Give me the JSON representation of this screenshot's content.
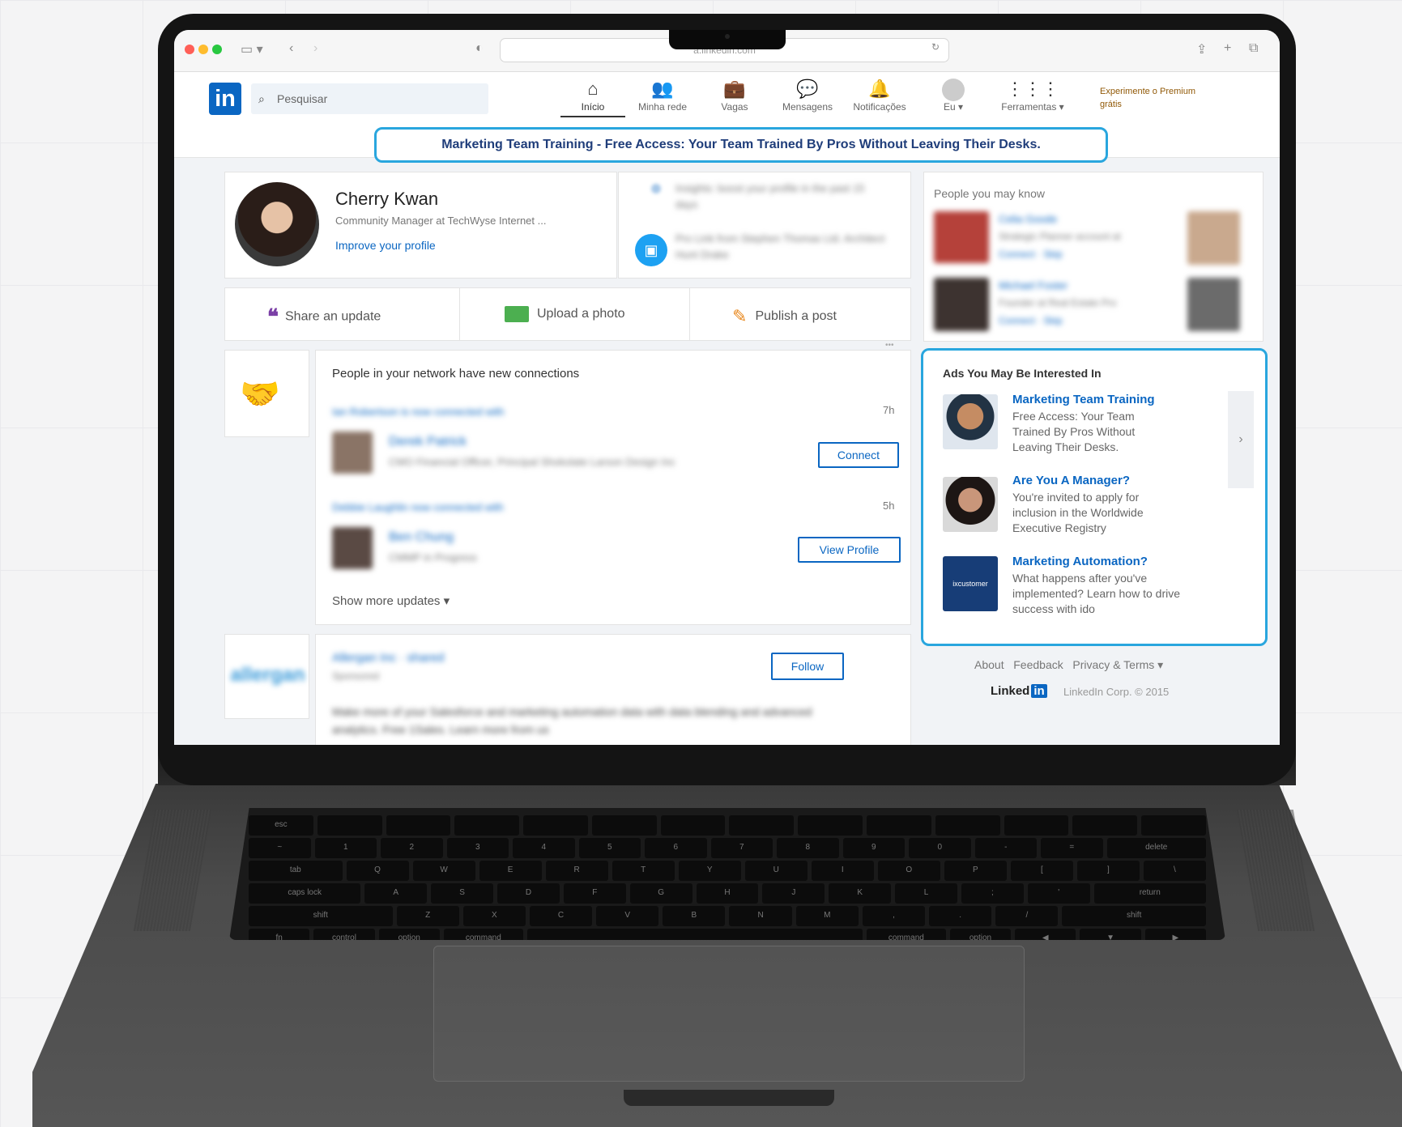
{
  "browser": {
    "url": "a.linkedin.com"
  },
  "linkedin": {
    "search_placeholder": "Pesquisar",
    "nav": [
      {
        "label": "Início",
        "icon": "home-icon"
      },
      {
        "label": "Minha rede",
        "icon": "network-icon"
      },
      {
        "label": "Vagas",
        "icon": "briefcase-icon"
      },
      {
        "label": "Mensagens",
        "icon": "message-icon"
      },
      {
        "label": "Notificações",
        "icon": "bell-icon"
      },
      {
        "label": "Eu ▾",
        "icon": "avatar-icon"
      },
      {
        "label": "Ferramentas ▾",
        "icon": "grid-icon"
      }
    ],
    "premium": "Experimente o Premium grátis"
  },
  "banner": "Marketing Team Training - Free Access: Your Team Trained By Pros Without Leaving Their Desks.",
  "profile": {
    "name": "Cherry Kwan",
    "headline": "Community Manager at TechWyse Internet ...",
    "improve": "Improve your profile",
    "side1": "Insights: boost your profile in the past 15 days",
    "side2": "Pro Link from Stephen Thomas Ltd. Architect Hunt Drake"
  },
  "share": {
    "update": "Share an update",
    "photo": "Upload a photo",
    "post": "Publish a post",
    "dots": "•••"
  },
  "feed": {
    "title": "People in your network have new connections",
    "items": [
      {
        "who": "Ian Robertson is now connected with",
        "time": "7h",
        "name": "Derek Patrick",
        "sub": "CMO Financial Officer, Principal Shokolate Larson Design Inc",
        "button": "Connect"
      },
      {
        "who": "Debbie Laughlin now connected with",
        "time": "5h",
        "name": "Ben Chung",
        "sub": "CMMP in Progress",
        "button": "View Profile"
      }
    ],
    "more": "Show more updates ▾"
  },
  "sponsored": {
    "logo": "allergan",
    "company": "Allergan Inc · shared",
    "tag": "Sponsored",
    "button": "Follow",
    "text": "Make more of your Salesforce and marketing automation data with data blending and advanced analytics. Free 1Sales. Learn more from us"
  },
  "pymk": {
    "title": "People you may know",
    "people": [
      {
        "name": "Celia Goode",
        "sub": "Strategic Planner account at",
        "conn": "Connect · Skip"
      },
      {
        "name": "Michael Foster",
        "sub": "Founder at Real Estate Pro",
        "conn": "Connect · Skip"
      }
    ]
  },
  "ads": {
    "title": "Ads You May Be Interested In",
    "items": [
      {
        "title": "Marketing Team Training",
        "desc": "Free Access: Your Team Trained By Pros Without Leaving Their Desks."
      },
      {
        "title": "Are You A Manager?",
        "desc": "You're invited to apply for inclusion in the Worldwide Executive Registry"
      },
      {
        "title": "Marketing Automation?",
        "desc": "What happens after you've implemented? Learn how to drive success with ido"
      }
    ],
    "logo3": "ixcustomer"
  },
  "footer": {
    "links": "About   Feedback   Privacy & Terms ▾",
    "brand": "Linked",
    "brand_in": "in",
    "copyright": "LinkedIn Corp. © 2015"
  },
  "colors": {
    "accent": "#29a6de",
    "linkedin_blue": "#0a66c2",
    "laptop": "#141414"
  }
}
